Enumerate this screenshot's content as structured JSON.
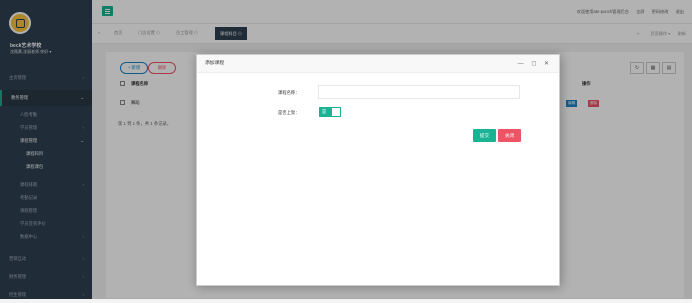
{
  "sidebar": {
    "school": "beck艺术学校",
    "user": "沈薇黄,沈丽老师,你好 ▾",
    "items": [
      {
        "label": "主页管理",
        "arrow": "‹"
      },
      {
        "label": "教务管理",
        "arrow": "⌄"
      },
      {
        "label": "人脸考勤"
      },
      {
        "label": "学员管理",
        "arrow": "‹"
      },
      {
        "label": "课程管理",
        "arrow": "⌄"
      },
      {
        "label": "课程科目"
      },
      {
        "label": "课程课包"
      },
      {
        "label": "课程排期",
        "arrow": "‹"
      },
      {
        "label": "考勤记录"
      },
      {
        "label": "请假管理"
      },
      {
        "label": "学员签到评价"
      },
      {
        "label": "数据中心",
        "arrow": "‹"
      },
      {
        "label": "营销互动",
        "arrow": "‹"
      },
      {
        "label": "财务管理",
        "arrow": "‹"
      },
      {
        "label": "招生管理",
        "arrow": "‹"
      }
    ]
  },
  "topbar": {
    "welcome": "欢迎使用ate-punch管理后台",
    "fullscreen": "全屏",
    "password": "密码修改",
    "logout": "退出"
  },
  "tabs": {
    "back": "«",
    "items": [
      "首页",
      "门店设置 ⊙",
      "员工管理 ⊙",
      "课程科目 ⊙"
    ],
    "forward": "»",
    "more": "页签操作 ▾",
    "refresh": "刷新"
  },
  "content": {
    "add": "+ 新增",
    "delete": "删除",
    "col_name": "课程名称",
    "col_ops": "操作",
    "row_name": "舞蹈",
    "edit": "编辑",
    "del": "删除",
    "pager": "第 1 到 1 条，共 1 条记录。"
  },
  "modal": {
    "title": "添加课程",
    "ctrls": "— ◻ ✕",
    "name_label": "课程名称：",
    "status_label": "是否上架：",
    "toggle": "是",
    "submit": "提交",
    "close": "关闭"
  }
}
